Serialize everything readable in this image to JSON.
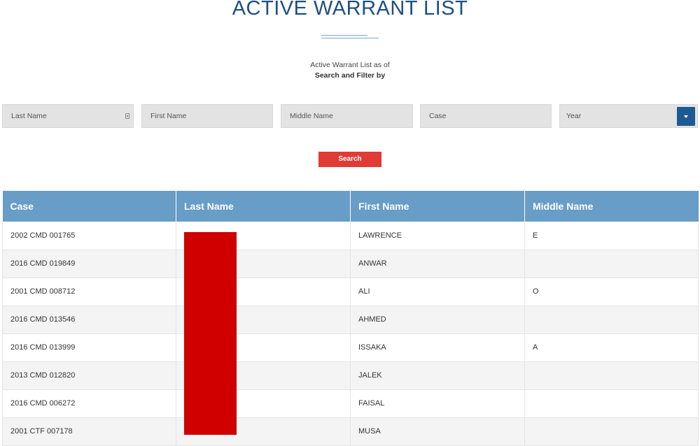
{
  "page": {
    "title": "ACTIVE WARRANT LIST",
    "subtitle": "Active Warrant List as of",
    "filter_label": "Search and Filter by"
  },
  "filters": {
    "last_name_placeholder": "Last Name",
    "first_name_placeholder": "First Name",
    "middle_name_placeholder": "Middle Name",
    "case_placeholder": "Case",
    "year_selected": "Year"
  },
  "search_button": {
    "label": "Search"
  },
  "colors": {
    "title": "#1d4f82",
    "header_bg": "#679dc6",
    "search_button": "#e03b35",
    "select_button": "#1d5a93",
    "redaction": "#d00000"
  },
  "table": {
    "columns": [
      "Case",
      "Last Name",
      "First Name",
      "Middle Name"
    ],
    "rows": [
      {
        "case": "2002 CMD 001765",
        "last_name": "",
        "first_name": "LAWRENCE",
        "middle_name": "E"
      },
      {
        "case": "2016 CMD 019849",
        "last_name": "",
        "first_name": "ANWAR",
        "middle_name": ""
      },
      {
        "case": "2001 CMD 008712",
        "last_name": "",
        "first_name": "ALI",
        "middle_name": "O"
      },
      {
        "case": "2016 CMD 013546",
        "last_name": "",
        "first_name": "AHMED",
        "middle_name": ""
      },
      {
        "case": "2016 CMD 013999",
        "last_name": "",
        "first_name": "ISSAKA",
        "middle_name": "A"
      },
      {
        "case": "2013 CMD 012820",
        "last_name": "",
        "first_name": "JALEK",
        "middle_name": ""
      },
      {
        "case": "2016 CMD 006272",
        "last_name": "",
        "first_name": "FAISAL",
        "middle_name": ""
      },
      {
        "case": "2001 CTF 007178",
        "last_name": "",
        "first_name": "MUSA",
        "middle_name": ""
      }
    ]
  }
}
